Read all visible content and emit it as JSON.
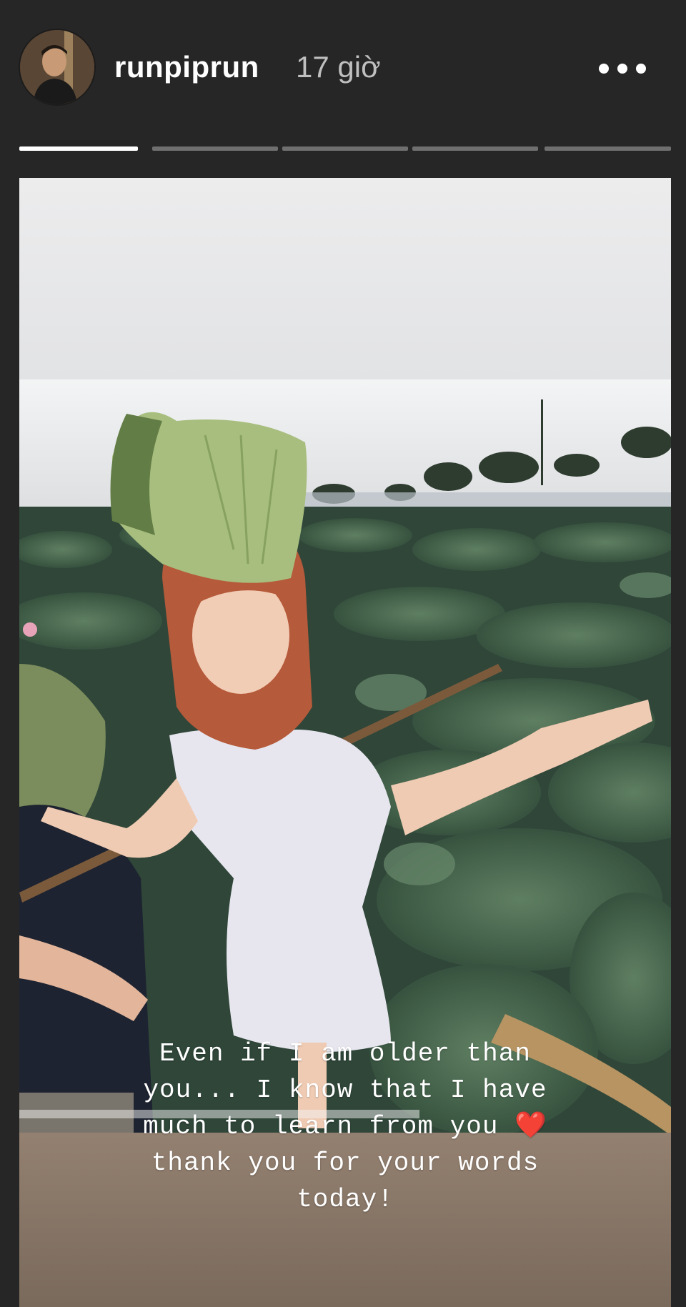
{
  "header": {
    "username": "runpiprun",
    "timestamp": "17 giờ",
    "more_icon": "more-horizontal-icon"
  },
  "progress": {
    "segments": 5,
    "active_index": 0
  },
  "story": {
    "caption_lines": [
      "Even if I am older than",
      "you... I know that I have",
      "much to learn from you",
      "thank you for your words",
      "today!"
    ],
    "heart_emoji": "❤️"
  },
  "colors": {
    "background": "#262626",
    "progress_active": "#ffffff",
    "progress_inactive": "#6f6f6f",
    "username": "#ffffff",
    "timestamp": "#bfbfbf"
  }
}
